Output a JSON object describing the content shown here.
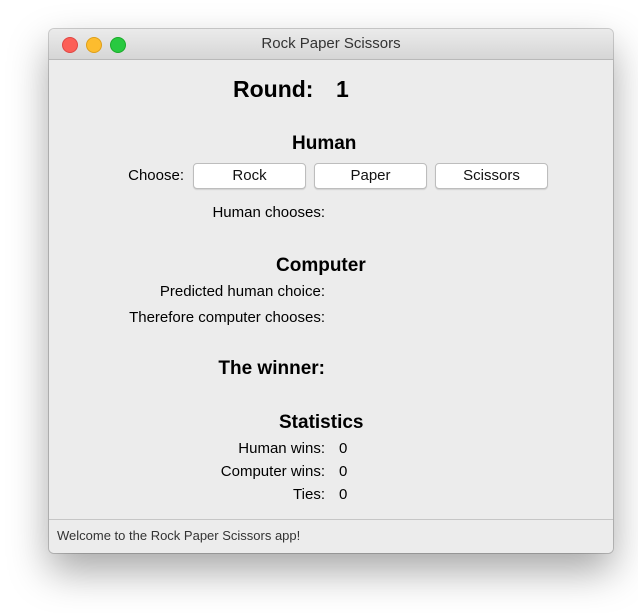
{
  "window": {
    "title": "Rock Paper Scissors"
  },
  "round": {
    "label": "Round:",
    "value": "1"
  },
  "human": {
    "heading": "Human",
    "choose_label": "Choose:",
    "buttons": [
      "Rock",
      "Paper",
      "Scissors"
    ],
    "chooses_label": "Human chooses:",
    "chooses_value": ""
  },
  "computer": {
    "heading": "Computer",
    "predicted_label": "Predicted human choice:",
    "predicted_value": "",
    "chooses_label": "Therefore computer chooses:",
    "chooses_value": ""
  },
  "winner": {
    "label": "The winner:",
    "value": ""
  },
  "statistics": {
    "heading": "Statistics",
    "human_wins_label": "Human wins:",
    "human_wins": "0",
    "computer_wins_label": "Computer wins:",
    "computer_wins": "0",
    "ties_label": "Ties:",
    "ties": "0"
  },
  "status": {
    "message": "Welcome to the Rock Paper Scissors app!"
  },
  "colors": {
    "close": "#fc5f57",
    "minimize": "#fdbc2e",
    "maximize": "#28c940",
    "window_bg": "#ececec"
  }
}
